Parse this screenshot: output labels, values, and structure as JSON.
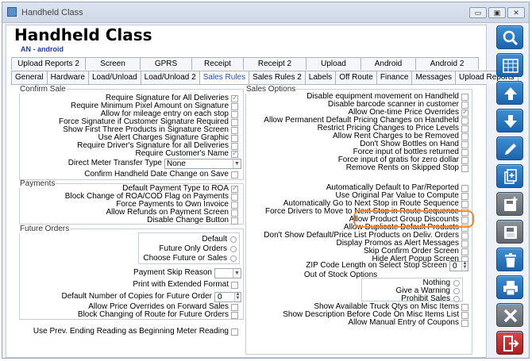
{
  "window": {
    "title": "Handheld Class",
    "min": "▭",
    "restore": "▣",
    "close": "✕"
  },
  "header": {
    "title": "Handheld Class",
    "subtitle": "AN - android"
  },
  "tabs_row1": [
    "Upload Reports 2",
    "Screen",
    "GPRS",
    "Receipt",
    "Receipt 2",
    "Upload",
    "Android",
    "Android 2"
  ],
  "tabs_row2": [
    "General",
    "Hardware",
    "Load/Unload",
    "Load/Unload 2",
    "Sales Rules",
    "Sales Rules 2",
    "Labels",
    "Off Route",
    "Finance",
    "Messages",
    "Upload Reports"
  ],
  "active_tab": "Sales Rules",
  "confirm_sale": {
    "legend": "Confirm Sale",
    "items": [
      {
        "label": "Require Signature for All Deliveries",
        "checked": true
      },
      {
        "label": "Require Minimum Pixel Amount on Signature",
        "checked": false
      },
      {
        "label": "Allow for mileage entry on each stop",
        "checked": false
      },
      {
        "label": "Force Signature if Customer Signature Required",
        "checked": false
      },
      {
        "label": "Show First Three Products in Signature Screen",
        "checked": false
      },
      {
        "label": "Use Alert Charges Signature Graphic",
        "checked": false
      },
      {
        "label": "Require Driver's Signature for all Deliveries",
        "checked": false
      },
      {
        "label": "Require Customer's Name",
        "checked": true
      }
    ],
    "meter_label": "Direct Meter Transfer Type",
    "meter_value": "None",
    "confirm_date": {
      "label": "Confirm Handheld Date Change on Save",
      "checked": false
    }
  },
  "payments": {
    "legend": "Payments",
    "items": [
      {
        "label": "Default Payment Type to ROA",
        "checked": true
      },
      {
        "label": "Block Change of ROA/COD Flag on Payments",
        "checked": false
      },
      {
        "label": "Force Payments to Own Invoice",
        "checked": false
      },
      {
        "label": "Allow Refunds on Payment Screen",
        "checked": false
      },
      {
        "label": "Disable Change Button",
        "checked": false
      }
    ]
  },
  "future_orders": {
    "legend": "Future Orders",
    "radios": [
      "Default",
      "Future Only Orders",
      "Choose Future or Sales"
    ],
    "skip_reason_label": "Payment Skip Reason",
    "skip_reason_value": "",
    "print_ext": {
      "label": "Print with Extended Format",
      "checked": false
    },
    "copies_label": "Default Number of Copies for Future Order",
    "copies_value": "0",
    "items": [
      {
        "label": "Allow Price Overrides on Forward Sales",
        "checked": false
      },
      {
        "label": "Block Changing of Route for Future Orders",
        "checked": false
      }
    ]
  },
  "meter_reading": {
    "label": "Use Prev. Ending Reading as Beginning Meter Reading",
    "checked": false
  },
  "sales_options": {
    "legend": "Sales Options",
    "items": [
      {
        "label": "Disable equipment movement on Handheld",
        "checked": false
      },
      {
        "label": "Disable barcode scanner in customer",
        "checked": false
      },
      {
        "label": "Allow One-time Price Overrides",
        "checked": true
      },
      {
        "label": "Allow Permanent Default Pricing Changes on Handheld",
        "checked": false
      },
      {
        "label": "Restrict Pricing Changes to Price Levels",
        "checked": false
      },
      {
        "label": "Allow Rent Charges to be Removed",
        "checked": false
      },
      {
        "label": "Don't Show Bottles on Hand",
        "checked": false
      },
      {
        "label": "Force input of bottles returned",
        "checked": false
      },
      {
        "label": "Force input of gratis for zero dollar",
        "checked": false
      },
      {
        "label": "Remove Rents on Skipped Stop",
        "checked": false
      }
    ],
    "items2": [
      {
        "label": "Automatically Default to Par/Reported",
        "checked": false
      },
      {
        "label": "Use Original Par Value to Compute",
        "checked": false
      },
      {
        "label": "Automatically Go to Next Stop in Route Sequence",
        "checked": false
      },
      {
        "label": "Force Drivers to Move to Next Stop in Route Sequence",
        "checked": false
      },
      {
        "label": "Allow Product Group Discounts",
        "checked": false
      },
      {
        "label": "Allow Duplicate Default Products",
        "checked": false
      },
      {
        "label": "Don't Show Default/Price List Products on Deliv. Orders",
        "checked": false
      },
      {
        "label": "Display Promos as Alert Messages",
        "checked": false
      },
      {
        "label": "Skip Confirm Order Screen",
        "checked": false
      },
      {
        "label": "Hide Alert Popup Screen",
        "checked": false
      }
    ],
    "zip_label": "ZIP Code Length on Select Stop Screen",
    "zip_value": "0",
    "out_of_stock": {
      "label": "Out of Stock Options",
      "radios": [
        "Nothing",
        "Give a Warning",
        "Prohibit Sales"
      ]
    },
    "items3": [
      {
        "label": "Show Available Truck Qtys on Misc Items",
        "checked": false
      },
      {
        "label": "Show Description Before Code On Misc Items List",
        "checked": false
      },
      {
        "label": "Allow Manual Entry of Coupons",
        "checked": false
      }
    ]
  },
  "sidebar": [
    {
      "icon": "search-icon"
    },
    {
      "icon": "grid-icon"
    },
    {
      "icon": "arrow-up-icon"
    },
    {
      "icon": "arrow-down-icon"
    },
    {
      "icon": "edit-icon"
    },
    {
      "icon": "copy-add-icon"
    },
    {
      "icon": "save-add-icon"
    },
    {
      "icon": "save-icon"
    },
    {
      "icon": "delete-icon"
    },
    {
      "icon": "print-icon"
    },
    {
      "icon": "cancel-icon"
    },
    {
      "icon": "exit-icon"
    }
  ],
  "colors": {
    "accent": "#1a64ad",
    "highlight": "#f08a2e",
    "subtitle": "#1a3fa8"
  }
}
